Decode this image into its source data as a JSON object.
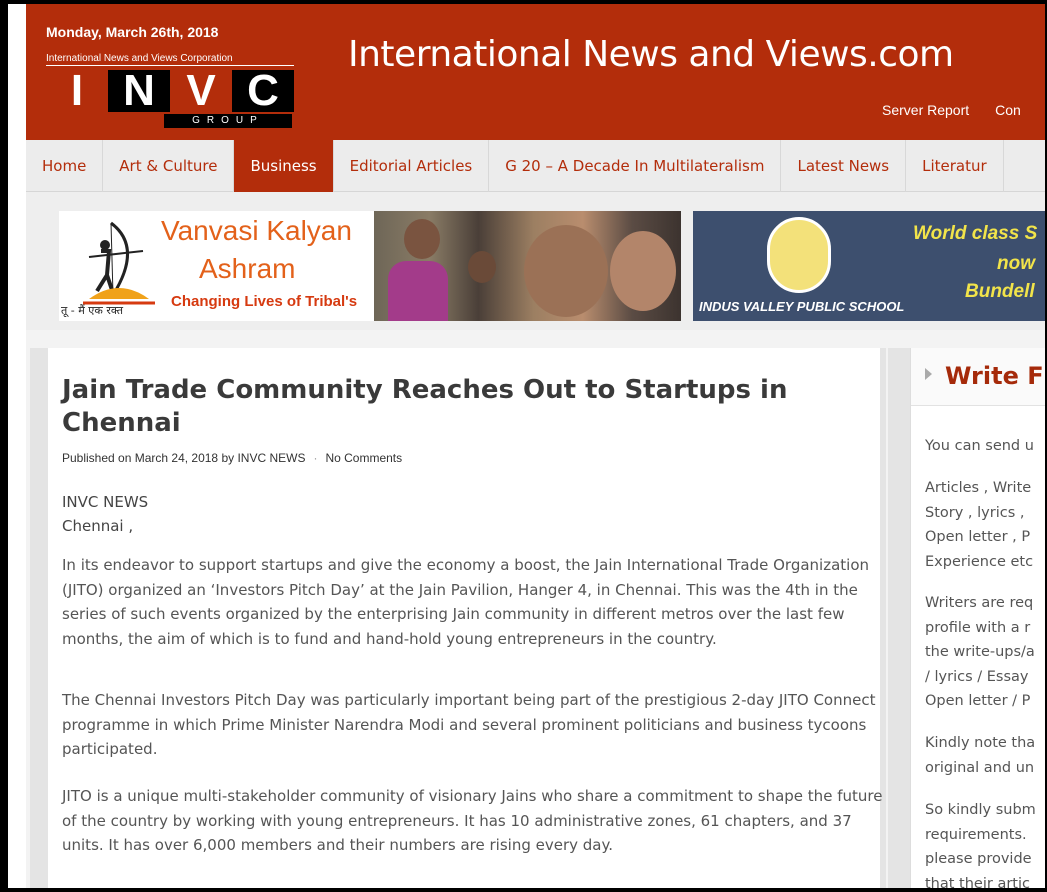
{
  "header": {
    "date": "Monday, March 26th, 2018",
    "logo_subtitle": "International News and Views Corporation",
    "logo_letters": [
      "I",
      "N",
      "V",
      "C"
    ],
    "logo_group": "GROUP",
    "site_title": "International News and Views.com",
    "top_links": [
      "Server Report",
      "Con"
    ]
  },
  "nav": {
    "items": [
      "Home",
      "Art & Culture",
      "Business",
      "Editorial Articles",
      "G 20 – A Decade In Multilateralism",
      "Latest News",
      "Literatur"
    ],
    "active": "Business"
  },
  "ads": {
    "ad1": {
      "name_line1": "Vanvasi Kalyan",
      "name_line2": "Ashram",
      "tagline": "Changing Lives of Tribal's",
      "hindi": "तू - मैं एक रक्त"
    },
    "ad2": {
      "school": "INDUS VALLEY PUBLIC SCHOOL",
      "line1": "World class S",
      "line2": "now",
      "line3": "Bundell"
    }
  },
  "article": {
    "title": "Jain Trade Community Reaches Out to Startups in Chennai",
    "meta_published": "Published on March 24, 2018 by INVC NEWS",
    "meta_separator": "·",
    "meta_comments": "No Comments",
    "byline_source": "INVC NEWS",
    "byline_city": "Chennai ,",
    "paragraphs": [
      "In its endeavor to support startups and give the economy a boost, the Jain International Trade Organization (JITO) organized an ‘Investors Pitch Day’ at the Jain Pavilion, Hanger 4, in Chennai. This was the 4th in the series of such events organized by the enterprising Jain community in different metros over the last few months, the aim of which is to fund and hand-hold young entrepreneurs in the country.",
      "The Chennai Investors Pitch Day was particularly important being part of the prestigious 2-day JITO Connect programme in which Prime Minister Narendra Modi and several prominent politicians and business tycoons participated.",
      "JITO is a unique multi-stakeholder community of visionary Jains who share a commitment to shape the future of the country by working with young entrepreneurs. It has 10 administrative zones, 61 chapters, and 37 units. It has over 6,000 members and their numbers are rising every day."
    ]
  },
  "sidebar": {
    "title": "Write F",
    "blocks": [
      "You can send u",
      "Articles , Write\nStory , lyrics ,\nOpen letter , P\nExperience etc",
      "Writers are req\nprofile with a r\nthe write-ups/a\n/ lyrics / Essay\nOpen letter / P",
      "Kindly note tha\noriginal and un",
      "So kindly subm\nrequirements.\nplease provide\nthat their artic"
    ]
  },
  "colors": {
    "brand": "#b32d0b",
    "nav_bg": "#ececec",
    "sidebar_title": "#a52a0a",
    "ad_orange": "#e3611a",
    "ad2_yellow": "#f2e44a"
  }
}
